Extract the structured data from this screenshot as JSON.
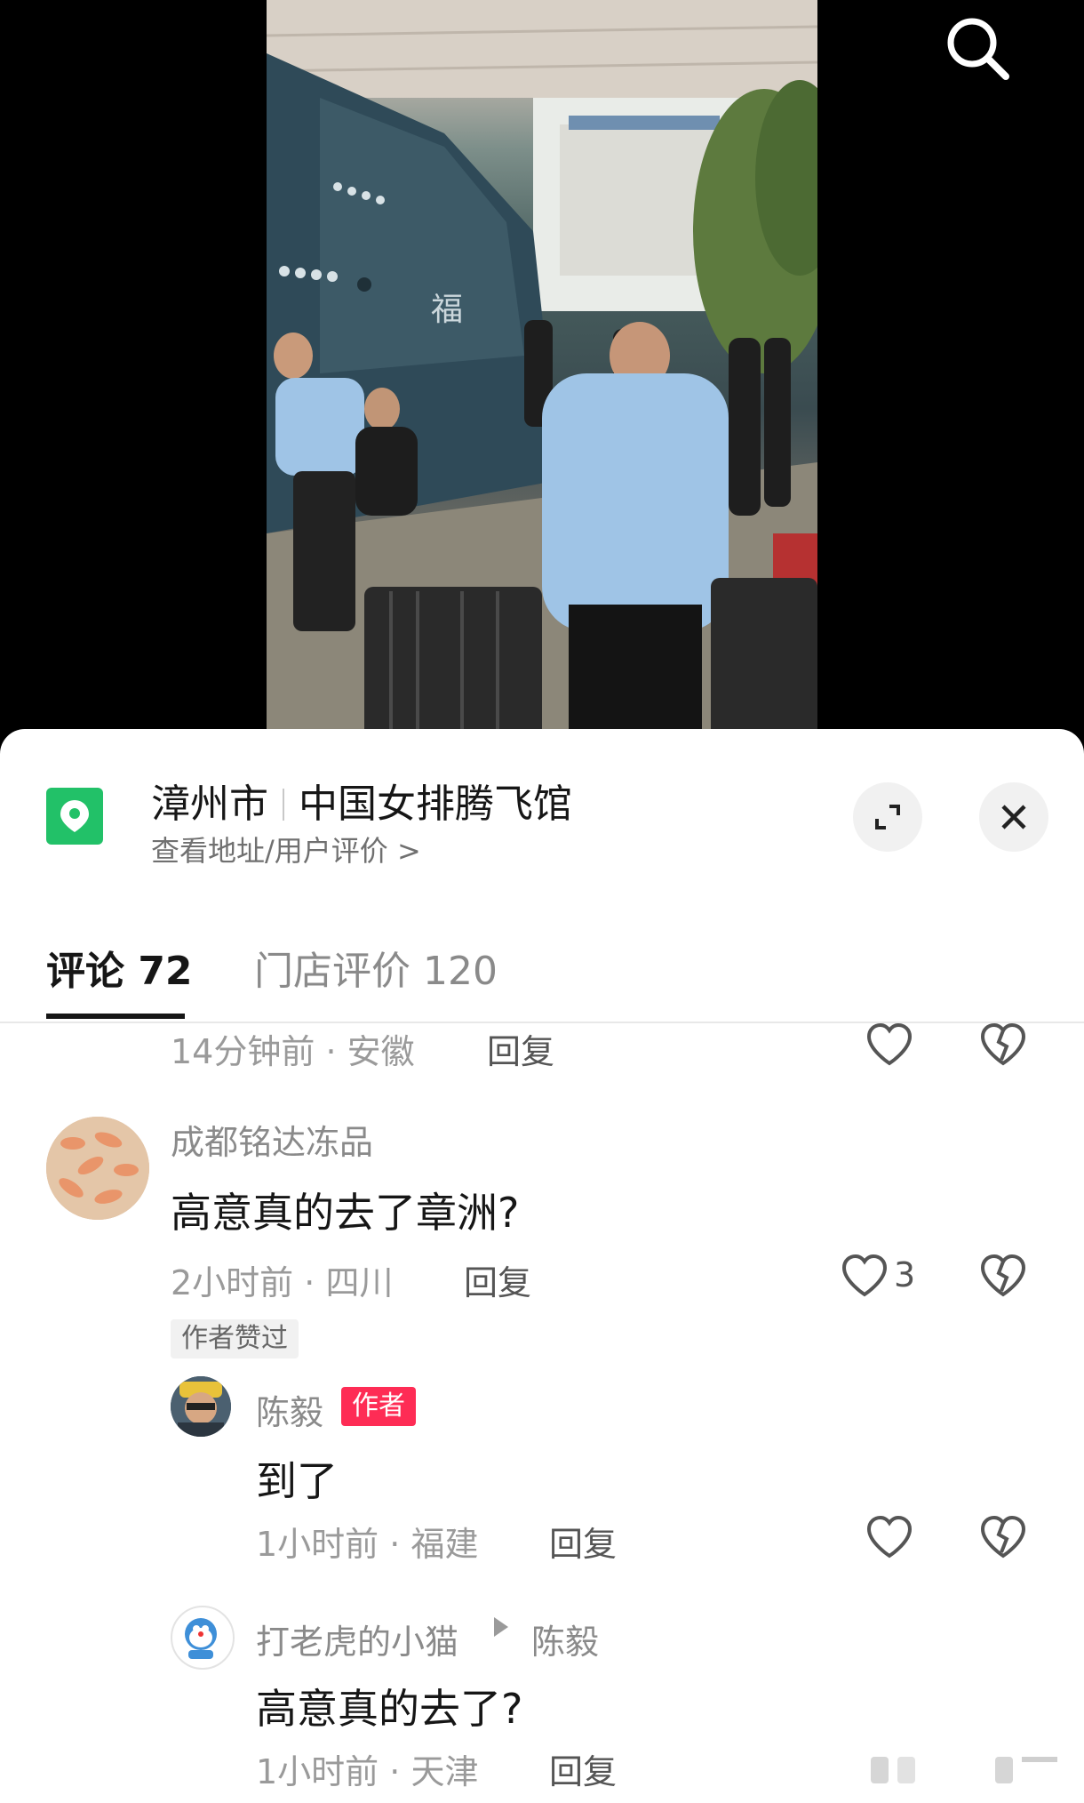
{
  "location": {
    "city": "漳州市",
    "venue": "中国女排腾飞馆",
    "subtitle": "查看地址/用户评价 >"
  },
  "tabs": [
    {
      "label": "评论 72",
      "active": true
    },
    {
      "label": "门店评价 120",
      "active": false
    }
  ],
  "comments": {
    "partial": {
      "time": "14分钟前",
      "sep": "·",
      "region": "安徽",
      "reply": "回复"
    },
    "first": {
      "user": "成都铭达冻品",
      "text": "高意真的去了章洲?",
      "time": "2小时前",
      "sep": "·",
      "region": "四川",
      "reply": "回复",
      "likes": "3",
      "badge": "作者赞过"
    },
    "author_reply": {
      "user": "陈毅",
      "badge": "作者",
      "text": "到了",
      "time": "1小时前",
      "sep": "·",
      "region": "福建",
      "reply": "回复"
    },
    "nested_reply": {
      "user": "打老虎的小猫",
      "target": "陈毅",
      "text": "高意真的去了?",
      "time": "1小时前",
      "sep": "·",
      "region": "天津",
      "reply": "回复"
    }
  },
  "colors": {
    "accent_red": "#fe2c55",
    "location_green": "#22c168"
  }
}
